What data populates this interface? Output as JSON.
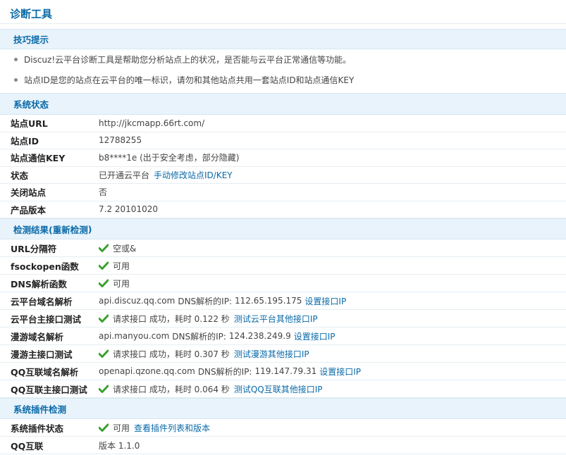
{
  "page": {
    "title": "诊断工具"
  },
  "tips": {
    "header": "技巧提示",
    "items": [
      "Discuz!云平台诊断工具是帮助您分析站点上的状况，是否能与云平台正常通信等功能。",
      "站点ID是您的站点在云平台的唯一标识，请勿和其他站点共用一套站点ID和站点通信KEY"
    ]
  },
  "status": {
    "header": "系统状态",
    "site_url": {
      "label": "站点URL",
      "value": "http://jkcmapp.66rt.com/"
    },
    "site_id": {
      "label": "站点ID",
      "value": "12788255"
    },
    "site_key": {
      "label": "站点通信KEY",
      "value": "b8****1e (出于安全考虑，部分隐藏)"
    },
    "state": {
      "label": "状态",
      "value": "已开通云平台",
      "link": "手动修改站点ID/KEY"
    },
    "closed": {
      "label": "关闭站点",
      "value": "否"
    },
    "version": {
      "label": "产品版本",
      "value": "7.2 20101020"
    }
  },
  "detect": {
    "header_prefix": "检测结果(",
    "redetect": "重新检测",
    "header_suffix": ")",
    "url_sep": {
      "label": "URL分隔符",
      "value": "空或&"
    },
    "fsockopen": {
      "label": "fsockopen函数",
      "value": "可用"
    },
    "dns_func": {
      "label": "DNS解析函数",
      "value": "可用"
    },
    "cloud_dns": {
      "label": "云平台域名解析",
      "host": "api.discuz.qq.com",
      "dns_label": "DNS解析的IP:",
      "ip": "112.65.195.175",
      "link": "设置接口IP"
    },
    "cloud_test": {
      "label": "云平台主接口测试",
      "value": "请求接口 成功，耗时 0.122 秒",
      "link": "测试云平台其他接口IP"
    },
    "manyou_dns": {
      "label": "漫游域名解析",
      "host": "api.manyou.com",
      "dns_label": "DNS解析的IP:",
      "ip": "124.238.249.9",
      "link": "设置接口IP"
    },
    "manyou_test": {
      "label": "漫游主接口测试",
      "value": "请求接口 成功，耗时 0.307 秒",
      "link": "测试漫游其他接口IP"
    },
    "qq_dns": {
      "label": "QQ互联域名解析",
      "host": "openapi.qzone.qq.com",
      "dns_label": "DNS解析的IP:",
      "ip": "119.147.79.31",
      "link": "设置接口IP"
    },
    "qq_test": {
      "label": "QQ互联主接口测试",
      "value": "请求接口 成功，耗时 0.064 秒",
      "link": "测试QQ互联其他接口IP"
    }
  },
  "plugins": {
    "header": "系统插件检测",
    "state": {
      "label": "系统插件状态",
      "value": "可用",
      "link": "查看插件列表和版本"
    },
    "qqconnect": {
      "label": "QQ互联",
      "value": "版本 1.1.0"
    }
  },
  "colors": {
    "accent": "#0a6aa8",
    "header_bg": "#e8f3fb",
    "ok_green": "#3aa02d"
  },
  "icons": {
    "ok": "check-icon"
  }
}
